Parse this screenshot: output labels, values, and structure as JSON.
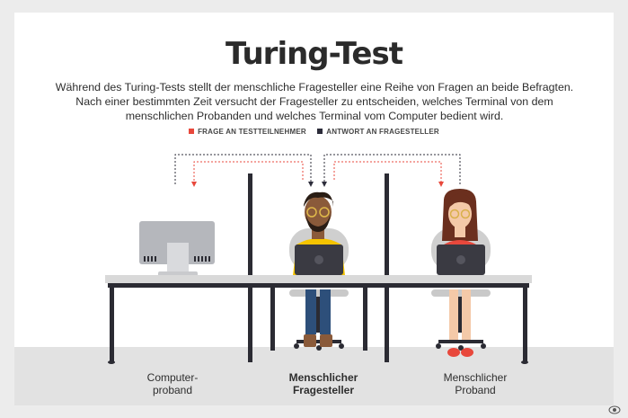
{
  "title": "Turing-Test",
  "description": "Während des Turing-Tests stellt der menschliche Fragesteller eine Reihe von Fragen an beide Befragten. Nach einer bestimmten Zeit versucht der Fragesteller zu entscheiden, welches Terminal von dem menschlichen Probanden und welches Terminal vom Computer bedient wird.",
  "legend": [
    {
      "label": "FRAGE AN TESTTEILNEHMER",
      "color": "#e8483c"
    },
    {
      "label": "ANTWORT AN FRAGESTELLER",
      "color": "#2c2c3a"
    }
  ],
  "labels": {
    "computer": "Computer-\nproband",
    "questioner": "Menschlicher\nFragesteller",
    "human": "Menschlicher\nProband"
  },
  "colors": {
    "question_arrow": "#e8483c",
    "answer_arrow": "#2c2c3a",
    "desk": "#d9d9d9",
    "shirt_yellow": "#f5c400",
    "dress_red": "#e8483c"
  }
}
